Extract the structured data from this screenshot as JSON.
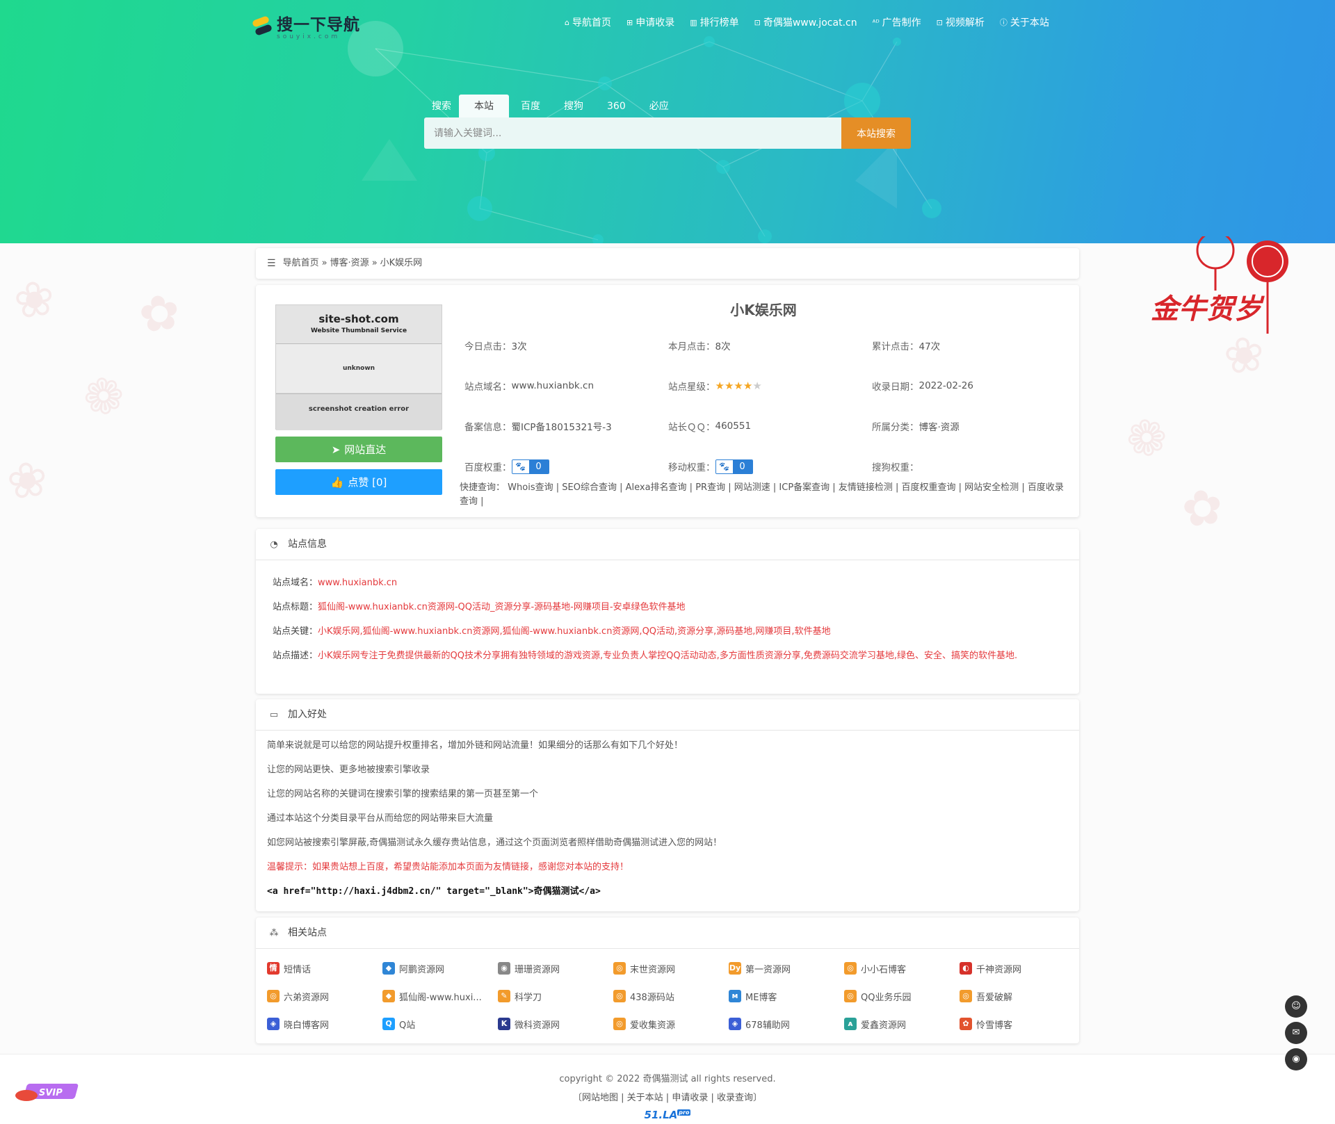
{
  "header": {
    "logo_title": "搜一下导航",
    "logo_sub": "souyix.com",
    "nav": [
      {
        "icon": "home-icon",
        "glyph": "⌂",
        "label": "导航首页"
      },
      {
        "icon": "plus-square-icon",
        "glyph": "⊞",
        "label": "申请收录"
      },
      {
        "icon": "bar-chart-icon",
        "glyph": "▥",
        "label": "排行榜单"
      },
      {
        "icon": "link-box-icon",
        "glyph": "⊡",
        "label": "奇偶猫www.jocat.cn"
      },
      {
        "icon": "ad-icon",
        "glyph": "ᴬᴰ",
        "label": "广告制作"
      },
      {
        "icon": "video-icon",
        "glyph": "⊡",
        "label": "视频解析"
      },
      {
        "icon": "info-circle-icon",
        "glyph": "ⓘ",
        "label": "关于本站"
      }
    ]
  },
  "search": {
    "tabs": [
      "搜索",
      "本站",
      "百度",
      "搜狗",
      "360",
      "必应"
    ],
    "active_tab": 1,
    "placeholder": "请输入关键词...",
    "button": "本站搜索"
  },
  "breadcrumb": {
    "home": "导航首页",
    "sep": "»",
    "category": "博客·资源",
    "current": "小K娱乐网"
  },
  "thumb": {
    "title": "site-shot.com",
    "subtitle": "Website Thumbnail Service",
    "status": "unknown",
    "error": "screenshot creation error"
  },
  "detail": {
    "visit_button": "网站直达",
    "like_button": "点赞 [0]",
    "title": "小K娱乐网",
    "rows": [
      [
        {
          "label": "今日点击：",
          "value": "3次"
        },
        {
          "label": "本月点击：",
          "value": "8次"
        },
        {
          "label": "累计点击：",
          "value": "47次"
        }
      ],
      [
        {
          "label": "站点域名：",
          "value": "www.huxianbk.cn"
        },
        {
          "label": "站点星级：",
          "stars": 4,
          "max_stars": 5
        },
        {
          "label": "收录日期：",
          "value": "2022-02-26"
        }
      ],
      [
        {
          "label": "备案信息：",
          "value": "蜀ICP备18015321号-3"
        },
        {
          "label": "站长ＱＱ：",
          "value": "460551"
        },
        {
          "label": "所属分类：",
          "value": "博客·资源"
        }
      ],
      [
        {
          "label": "百度权重：",
          "badge": "0"
        },
        {
          "label": "移动权重：",
          "badge": "0"
        },
        {
          "label": "搜狗权重：",
          "value": ""
        }
      ]
    ],
    "quick_label": "快捷查询：",
    "quick_links": [
      "Whois查询",
      "SEO综合查询",
      "Alexa排名查询",
      "PR查询",
      "网站测速",
      "ICP备案查询",
      "友情链接检测",
      "百度权重查询",
      "网站安全检测",
      "百度收录查询"
    ]
  },
  "site_info": {
    "heading": "站点信息",
    "items": [
      {
        "label": "站点域名：",
        "value": "www.huxianbk.cn"
      },
      {
        "label": "站点标题：",
        "value": "狐仙阁-www.huxianbk.cn资源网-QQ活动_资源分享-源码基地-网赚项目-安卓绿色软件基地"
      },
      {
        "label": "站点关键：",
        "value": "小K娱乐网,狐仙阁-www.huxianbk.cn资源网,狐仙阁-www.huxianbk.cn资源网,QQ活动,资源分享,源码基地,网赚项目,软件基地"
      },
      {
        "label": "站点描述：",
        "value": "小K娱乐网专注于免费提供最新的QQ技术分享拥有独特领域的游戏资源,专业负责人掌控QQ活动动态,多方面性质资源分享,免费源码交流学习基地,绿色、安全、搞笑的软件基地."
      }
    ]
  },
  "benefit": {
    "heading": "加入好处",
    "lines": [
      "简单来说就是可以给您的网站提升权重排名，增加外链和网站流量！如果细分的话那么有如下几个好处！",
      "让您的网站更快、更多地被搜索引擎收录",
      "让您的网站名称的关键词在搜索引擎的搜索结果的第一页甚至第一个",
      "通过本站这个分类目录平台从而给您的网站带来巨大流量",
      "如您网站被搜索引擎屏蔽,奇偶猫测试永久缓存贵站信息，通过这个页面浏览者照样借助奇偶猫测试进入您的网站！"
    ],
    "warn": "温馨提示：如果贵站想上百度，希望贵站能添加本页面为友情链接，感谢您对本站的支持！",
    "code": "<a href=\"http://haxi.j4dbm2.cn/\" target=\"_blank\">奇偶猫测试</a>"
  },
  "related": {
    "heading": "相关站点",
    "items": [
      {
        "name": "短情话",
        "color": "#e23a2e",
        "glyph": "情"
      },
      {
        "name": "阿鹏资源网",
        "color": "#2f86d6",
        "glyph": "◆"
      },
      {
        "name": "珊珊资源网",
        "color": "#888888",
        "glyph": "◉"
      },
      {
        "name": "末世资源网",
        "color": "#f29b2c",
        "glyph": "◎"
      },
      {
        "name": "第一资源网",
        "color": "#f29b2c",
        "glyph": "Dy"
      },
      {
        "name": "小小石博客",
        "color": "#f29b2c",
        "glyph": "◎"
      },
      {
        "name": "千神资源网",
        "color": "#d6322b",
        "glyph": "◐"
      },
      {
        "name": "六弟资源网",
        "color": "#f29b2c",
        "glyph": "◎"
      },
      {
        "name": "狐仙阁-www.huxi...",
        "color": "#f29b2c",
        "glyph": "◆"
      },
      {
        "name": "科学刀",
        "color": "#f29b2c",
        "glyph": "✎"
      },
      {
        "name": "438源码站",
        "color": "#f29b2c",
        "glyph": "◎"
      },
      {
        "name": "ME博客",
        "color": "#2f86d6",
        "glyph": "ᴍ"
      },
      {
        "name": "QQ业务乐园",
        "color": "#f29b2c",
        "glyph": "◎"
      },
      {
        "name": "吾爱破解",
        "color": "#f29b2c",
        "glyph": "◎"
      },
      {
        "name": "晓白博客网",
        "color": "#3b5fd6",
        "glyph": "◈"
      },
      {
        "name": "Q站",
        "color": "#1e9fff",
        "glyph": "Q"
      },
      {
        "name": "微科资源网",
        "color": "#2b3a8f",
        "glyph": "K"
      },
      {
        "name": "爱收集资源",
        "color": "#f29b2c",
        "glyph": "◎"
      },
      {
        "name": "678辅助网",
        "color": "#3b5fd6",
        "glyph": "◈"
      },
      {
        "name": "爱鑫资源网",
        "color": "#2aa198",
        "glyph": "ᴀ"
      },
      {
        "name": "怜雪博客",
        "color": "#e2532e",
        "glyph": "✿"
      }
    ]
  },
  "footer": {
    "copyright": "copyright © 2022 奇偶猫测试 all rights reserved.",
    "links": [
      "网站地图",
      "关于本站",
      "申请收录",
      "收录查询"
    ],
    "stat_label": "51.LA",
    "stat_badge": "pro"
  },
  "floats": {
    "svip": "SVIP",
    "newyear": "金牛贺岁"
  },
  "colors": {
    "accent_orange": "#e58e26",
    "visit_green": "#5cb85c",
    "like_blue": "#1e9fff",
    "value_red": "#e4393c"
  }
}
